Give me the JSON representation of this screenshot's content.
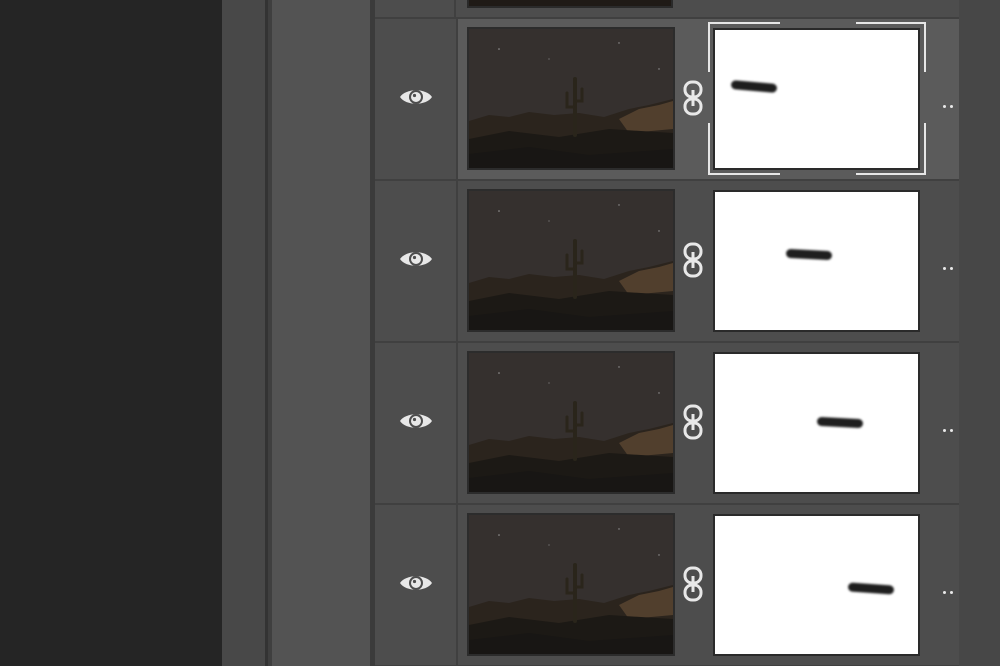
{
  "panel": {
    "name": "layers-panel"
  },
  "layers": [
    {
      "id": "layer-1",
      "visible": true,
      "selected": true,
      "mask_stroke_fraction": 0.1
    },
    {
      "id": "layer-2",
      "visible": true,
      "selected": false,
      "mask_stroke_fraction": 0.45
    },
    {
      "id": "layer-3",
      "visible": true,
      "selected": false,
      "mask_stroke_fraction": 0.65
    },
    {
      "id": "layer-4",
      "visible": true,
      "selected": false,
      "mask_stroke_fraction": 0.85
    }
  ],
  "icons": {
    "visibility": "eye-icon",
    "link": "chain-link-icon",
    "more": "more-dots-icon"
  },
  "colors": {
    "panel_bg": "#404040",
    "row_bg": "#4d4d4d",
    "row_selected_bg": "#5b5b5b",
    "mask_bg": "#ffffff",
    "icon": "#e8e8e8"
  }
}
